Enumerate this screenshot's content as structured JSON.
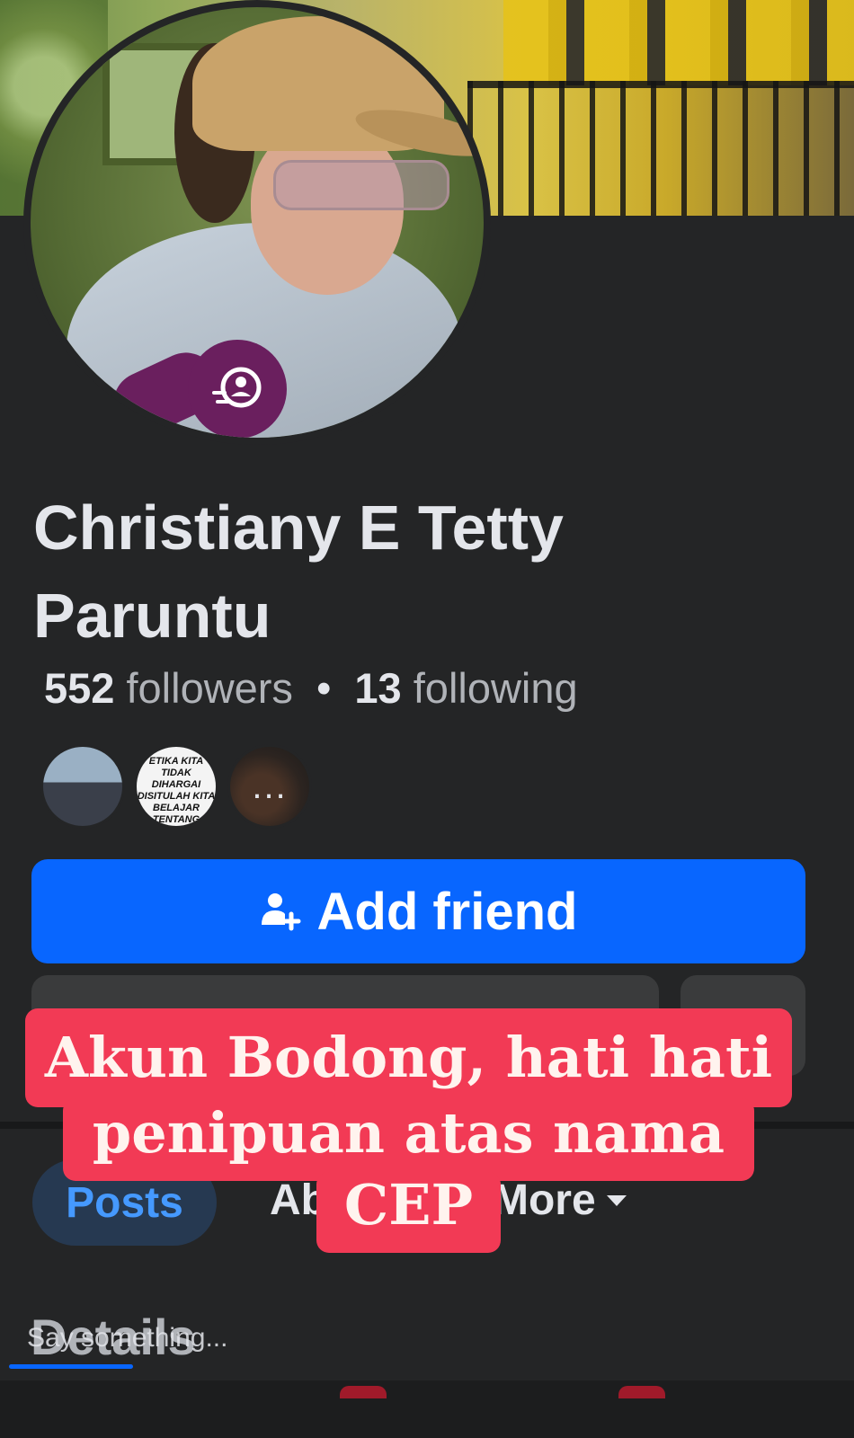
{
  "profile": {
    "name": "Christiany E Tetty Paruntu",
    "followers_count": "552",
    "followers_label": "followers",
    "following_count": "13",
    "following_label": "following",
    "separator": "•"
  },
  "mutual_friends": {
    "thumb2_text": "ETIKA KITA TIDAK DIHARGAI DISITULAH KITA BELAJAR TENTANG KESABARAN",
    "more_label": "..."
  },
  "actions": {
    "add_friend_label": "Add friend",
    "add_friend_icon": "add-person-icon"
  },
  "tabs": {
    "posts": "Posts",
    "about": "Ab",
    "more": "More"
  },
  "details": {
    "heading": "Details",
    "composer_placeholder": "Say something..."
  },
  "overlay": {
    "line1": "Akun Bodong, hati hati",
    "line2": "penipuan atas nama",
    "line3": "CEP",
    "color": "#f23a55"
  },
  "colors": {
    "background": "#242526",
    "primary_button": "#0866ff",
    "tab_active_bg": "#263951",
    "tab_active_text": "#4599ff"
  }
}
